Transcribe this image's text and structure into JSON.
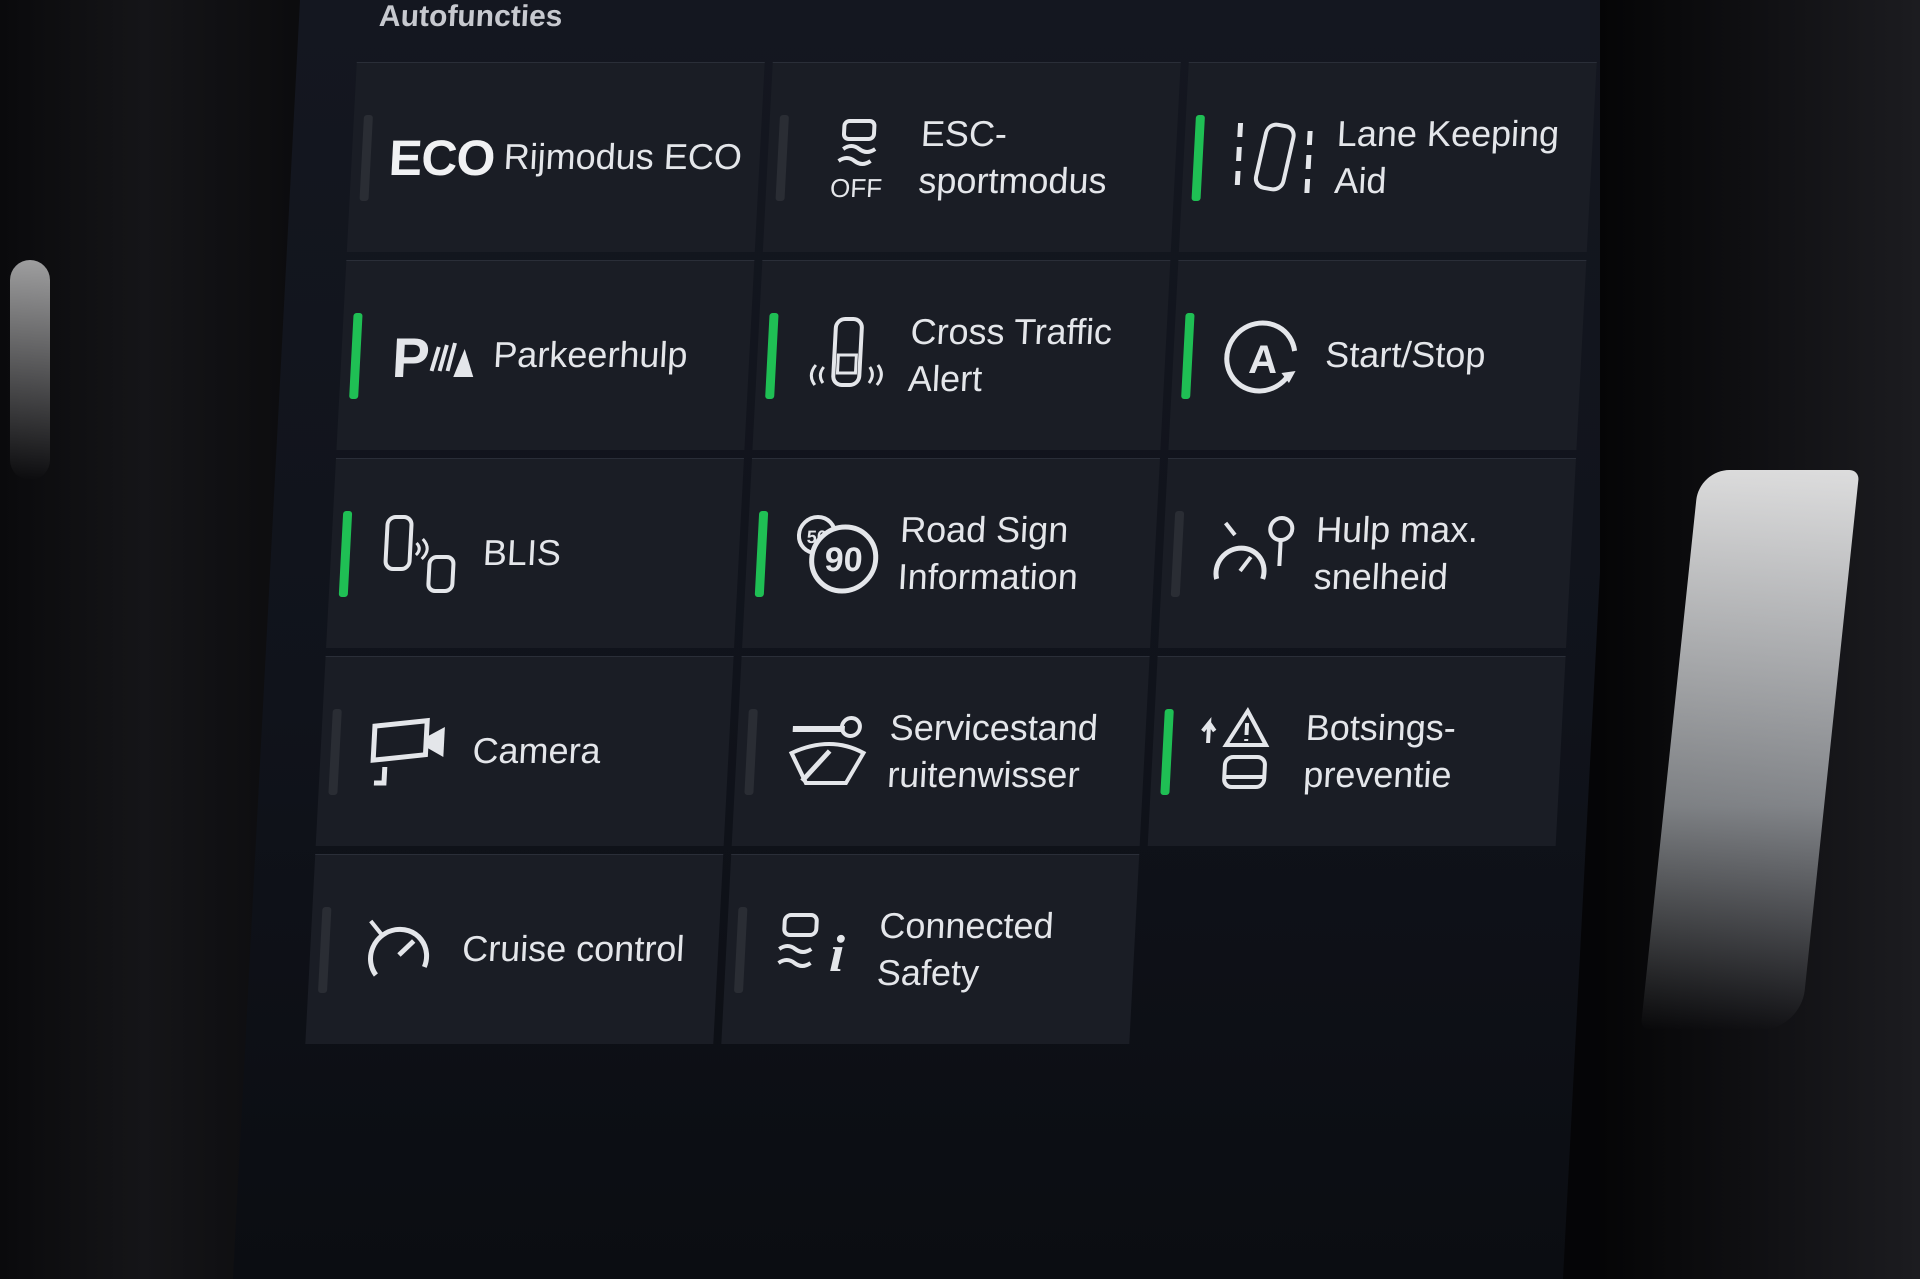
{
  "screen": {
    "title": "Autofuncties"
  },
  "tiles": [
    {
      "label": "Rijmodus ECO",
      "icon": "eco-icon",
      "icon_text": "ECO",
      "active": false
    },
    {
      "label": "ESC-sportmodus",
      "icon": "esc-off-icon",
      "icon_text": "OFF",
      "active": false
    },
    {
      "label": "Lane Keeping\nAid",
      "icon": "lane-keeping-icon",
      "active": true
    },
    {
      "label": "Parkeerhulp",
      "icon": "park-assist-icon",
      "icon_text": "P",
      "active": true
    },
    {
      "label": "Cross Traffic\nAlert",
      "icon": "cross-traffic-icon",
      "active": true
    },
    {
      "label": "Start/Stop",
      "icon": "start-stop-icon",
      "icon_text": "A",
      "active": true
    },
    {
      "label": "BLIS",
      "icon": "blis-icon",
      "active": true
    },
    {
      "label": "Road Sign\nInformation",
      "icon": "road-sign-icon",
      "icon_text": "90",
      "icon_text_small": "50",
      "active": true
    },
    {
      "label": "Hulp max.\nsnelheid",
      "icon": "speed-limiter-icon",
      "active": false
    },
    {
      "label": "Camera",
      "icon": "camera-icon",
      "active": false
    },
    {
      "label": "Servicestand\nruitenwisser",
      "icon": "wiper-service-icon",
      "active": false
    },
    {
      "label": "Botsings-\npreventie",
      "icon": "collision-warning-icon",
      "active": true
    },
    {
      "label": "Cruise control",
      "icon": "cruise-control-icon",
      "active": false
    },
    {
      "label": "Connected\nSafety",
      "icon": "connected-safety-icon",
      "icon_text": "i",
      "active": false
    }
  ],
  "colors": {
    "active": "#1fbf54",
    "inactive": "#2a2d34",
    "tile": "#1a1d25",
    "text": "#e4e6ea"
  }
}
